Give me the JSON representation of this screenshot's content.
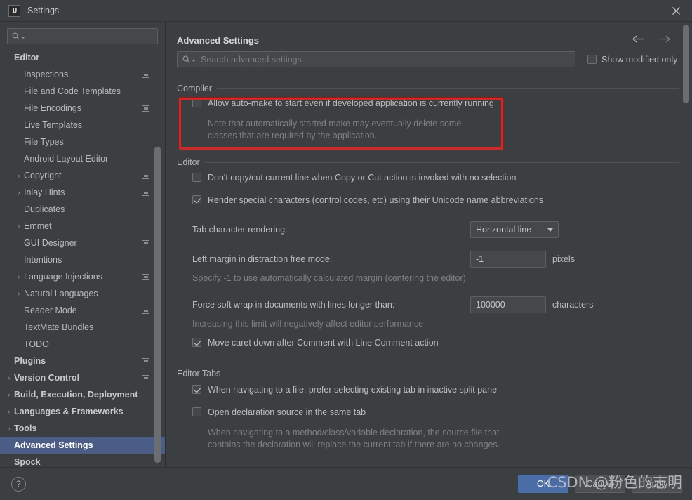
{
  "window": {
    "title": "Settings",
    "logo_text": "IJ",
    "close_icon": "close-icon"
  },
  "sidebar": {
    "search_placeholder": "",
    "items": [
      {
        "label": "Editor",
        "bold": true,
        "indent": 0,
        "chevron": "",
        "badge": false,
        "selected": false
      },
      {
        "label": "Inspections",
        "bold": false,
        "indent": 1,
        "chevron": "",
        "badge": true,
        "selected": false
      },
      {
        "label": "File and Code Templates",
        "bold": false,
        "indent": 1,
        "chevron": "",
        "badge": false,
        "selected": false
      },
      {
        "label": "File Encodings",
        "bold": false,
        "indent": 1,
        "chevron": "",
        "badge": true,
        "selected": false
      },
      {
        "label": "Live Templates",
        "bold": false,
        "indent": 1,
        "chevron": "",
        "badge": false,
        "selected": false
      },
      {
        "label": "File Types",
        "bold": false,
        "indent": 1,
        "chevron": "",
        "badge": false,
        "selected": false
      },
      {
        "label": "Android Layout Editor",
        "bold": false,
        "indent": 1,
        "chevron": "",
        "badge": false,
        "selected": false
      },
      {
        "label": "Copyright",
        "bold": false,
        "indent": 1,
        "chevron": "›",
        "badge": true,
        "selected": false
      },
      {
        "label": "Inlay Hints",
        "bold": false,
        "indent": 1,
        "chevron": "›",
        "badge": true,
        "selected": false
      },
      {
        "label": "Duplicates",
        "bold": false,
        "indent": 1,
        "chevron": "",
        "badge": false,
        "selected": false
      },
      {
        "label": "Emmet",
        "bold": false,
        "indent": 1,
        "chevron": "›",
        "badge": false,
        "selected": false
      },
      {
        "label": "GUI Designer",
        "bold": false,
        "indent": 1,
        "chevron": "",
        "badge": true,
        "selected": false
      },
      {
        "label": "Intentions",
        "bold": false,
        "indent": 1,
        "chevron": "",
        "badge": false,
        "selected": false
      },
      {
        "label": "Language Injections",
        "bold": false,
        "indent": 1,
        "chevron": "›",
        "badge": true,
        "selected": false
      },
      {
        "label": "Natural Languages",
        "bold": false,
        "indent": 1,
        "chevron": "›",
        "badge": false,
        "selected": false
      },
      {
        "label": "Reader Mode",
        "bold": false,
        "indent": 1,
        "chevron": "",
        "badge": true,
        "selected": false
      },
      {
        "label": "TextMate Bundles",
        "bold": false,
        "indent": 1,
        "chevron": "",
        "badge": false,
        "selected": false
      },
      {
        "label": "TODO",
        "bold": false,
        "indent": 1,
        "chevron": "",
        "badge": false,
        "selected": false
      },
      {
        "label": "Plugins",
        "bold": true,
        "indent": 0,
        "chevron": "",
        "badge": true,
        "selected": false
      },
      {
        "label": "Version Control",
        "bold": true,
        "indent": 0,
        "chevron": "›",
        "badge": true,
        "selected": false
      },
      {
        "label": "Build, Execution, Deployment",
        "bold": true,
        "indent": 0,
        "chevron": "›",
        "badge": false,
        "selected": false
      },
      {
        "label": "Languages & Frameworks",
        "bold": true,
        "indent": 0,
        "chevron": "›",
        "badge": false,
        "selected": false
      },
      {
        "label": "Tools",
        "bold": true,
        "indent": 0,
        "chevron": "›",
        "badge": false,
        "selected": false
      },
      {
        "label": "Advanced Settings",
        "bold": true,
        "indent": 0,
        "chevron": "",
        "badge": false,
        "selected": true
      },
      {
        "label": "Spock",
        "bold": true,
        "indent": 0,
        "chevron": "",
        "badge": false,
        "selected": false
      }
    ]
  },
  "header": {
    "title": "Advanced Settings",
    "back_icon": "arrow-left-icon",
    "forward_icon": "arrow-right-icon"
  },
  "search": {
    "placeholder": "Search advanced settings",
    "value": "",
    "icon": "search-icon"
  },
  "show_modified": {
    "label": "Show modified only",
    "checked": false
  },
  "groups": {
    "compiler": {
      "title": "Compiler",
      "option_label": "Allow auto-make to start even if developed application is currently running",
      "option_checked": false,
      "note": "Note that automatically started make may eventually delete some classes that are required by the application."
    },
    "editor": {
      "title": "Editor",
      "opt1_label": "Don't copy/cut current line when Copy or Cut action is invoked with no selection",
      "opt1_checked": false,
      "opt2_label": "Render special characters (control codes, etc) using their Unicode name abbreviations",
      "opt2_checked": true,
      "tab_render_label": "Tab character rendering:",
      "tab_render_value": "Horizontal line",
      "left_margin_label": "Left margin in distraction free mode:",
      "left_margin_value": "-1",
      "left_margin_unit": "pixels",
      "left_margin_hint": "Specify -1 to use automatically calculated margin (centering the editor)",
      "soft_wrap_label": "Force soft wrap in documents with lines longer than:",
      "soft_wrap_value": "100000",
      "soft_wrap_unit": "characters",
      "soft_wrap_hint": "Increasing this limit will negatively affect editor performance",
      "opt3_label": "Move caret down after Comment with Line Comment action",
      "opt3_checked": true
    },
    "editor_tabs": {
      "title": "Editor Tabs",
      "opt1_label": "When navigating to a file, prefer selecting existing tab in inactive split pane",
      "opt1_checked": true,
      "opt2_label": "Open declaration source in the same tab",
      "opt2_checked": false,
      "note": "When navigating to a method/class/variable declaration, the source file that contains the declaration will replace the current tab if there are no changes."
    }
  },
  "footer": {
    "help_label": "?",
    "ok_label": "OK",
    "cancel_label": "Cancel",
    "apply_label": "Apply"
  },
  "watermark": "CSDN @粉色的志明",
  "colors": {
    "accent_blue": "#4a6da7",
    "selection_blue": "#4b5c86",
    "annotation_red": "#ee1b1b",
    "background": "#3c3f41"
  }
}
